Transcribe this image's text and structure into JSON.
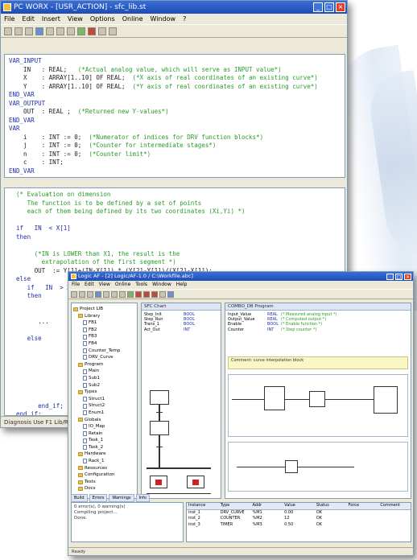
{
  "win1": {
    "title": "PC WORX - [USR_ACTION] - sfc_lib.st",
    "menu": [
      "File",
      "Edit",
      "Insert",
      "View",
      "Options",
      "Online",
      "Window",
      "?"
    ],
    "decl_lines": [
      {
        "c": "kw",
        "t": "VAR_INPUT"
      },
      {
        "c": "tx",
        "t": "    IN   : REAL;   "
      },
      {
        "c": "tx",
        "t": "    X    : ARRAY[1..10] OF REAL;  "
      },
      {
        "c": "tx",
        "t": "    Y    : ARRAY[1..10] OF REAL;  "
      },
      {
        "c": "kw",
        "t": "END_VAR"
      },
      {
        "c": "kw",
        "t": "VAR_OUTPUT"
      },
      {
        "c": "tx",
        "t": "    OUT  : REAL ;  "
      },
      {
        "c": "kw",
        "t": "END_VAR"
      },
      {
        "c": "kw",
        "t": "VAR"
      },
      {
        "c": "tx",
        "t": "    i    : INT := 0;  "
      },
      {
        "c": "tx",
        "t": "    j    : INT := 0;  "
      },
      {
        "c": "tx",
        "t": "    n    : INT := 0;  "
      },
      {
        "c": "tx",
        "t": "    c    : INT;"
      },
      {
        "c": "kw",
        "t": "END_VAR"
      }
    ],
    "decl_comments": [
      "(*Actual analog value, which will serve as INPUT value*)",
      "(*X axis of real coordinates of an existing curve*)",
      "(*Y axis of real coordinates of an existing curve*)",
      "(*Returned new Y-values*)",
      "(*Numerator of indices for DRV function blocks*)",
      "(*Counter for intermediate stages*)",
      "(*Counter limit*)"
    ],
    "body_lines": [
      {
        "c": "cm",
        "t": "  (* Evaluation on dimension"
      },
      {
        "c": "cm",
        "t": "     The function is to be defined by a set of points"
      },
      {
        "c": "cm",
        "t": "     each of them being defined by its two coordinates (Xi,Yi) *)"
      },
      {
        "c": "tx",
        "t": ""
      },
      {
        "c": "kw",
        "t": "  if   IN  < X[1]"
      },
      {
        "c": "kw",
        "t": "  then"
      },
      {
        "c": "tx",
        "t": ""
      },
      {
        "c": "cm",
        "t": "       (*IN is LOWER than X1, the result is the"
      },
      {
        "c": "cm",
        "t": "         extrapolation of the first segment *)"
      },
      {
        "c": "tx",
        "t": "       OUT  := Y[1]+(IN-X[1]) * (Y[2]-Y[1])/(X[2]-X[1]);"
      },
      {
        "c": "kw",
        "t": "  else"
      },
      {
        "c": "kw",
        "t": "     if   IN  > X[n]"
      },
      {
        "c": "kw",
        "t": "     then"
      },
      {
        "c": "tx",
        "t": ""
      },
      {
        "c": "tx",
        "t": ""
      },
      {
        "c": "tx",
        "t": "        ..."
      },
      {
        "c": "tx",
        "t": ""
      },
      {
        "c": "kw",
        "t": "     else"
      },
      {
        "c": "tx",
        "t": ""
      },
      {
        "c": "tx",
        "t": ""
      },
      {
        "c": "tx",
        "t": ""
      },
      {
        "c": "tx",
        "t": ""
      },
      {
        "c": "tx",
        "t": ""
      },
      {
        "c": "tx",
        "t": ""
      },
      {
        "c": "tx",
        "t": ""
      },
      {
        "c": "kw",
        "t": "        end_if;"
      },
      {
        "c": "kw",
        "t": "  end_if;"
      }
    ],
    "status": "Diagnosis Use F1 Lib/RDL"
  },
  "win2": {
    "title": "Logic AF - [2] Logic/AF-1.0 / C:\\Workfile.abc]",
    "menu": [
      "File",
      "Edit",
      "View",
      "Online",
      "Tools",
      "Window",
      "Help"
    ],
    "tree": [
      {
        "d": 0,
        "k": "f",
        "t": "Project LIB"
      },
      {
        "d": 1,
        "k": "f",
        "t": "Library"
      },
      {
        "d": 2,
        "k": "p",
        "t": "FB1"
      },
      {
        "d": 2,
        "k": "p",
        "t": "FB2"
      },
      {
        "d": 2,
        "k": "p",
        "t": "FB3"
      },
      {
        "d": 2,
        "k": "p",
        "t": "FB4"
      },
      {
        "d": 2,
        "k": "p",
        "t": "Counter_Temp"
      },
      {
        "d": 2,
        "k": "p",
        "t": "DRV_Curve"
      },
      {
        "d": 1,
        "k": "f",
        "t": "Program"
      },
      {
        "d": 2,
        "k": "p",
        "t": "Main"
      },
      {
        "d": 2,
        "k": "p",
        "t": "Sub1"
      },
      {
        "d": 2,
        "k": "p",
        "t": "Sub2"
      },
      {
        "d": 1,
        "k": "f",
        "t": "Types"
      },
      {
        "d": 2,
        "k": "p",
        "t": "Struct1"
      },
      {
        "d": 2,
        "k": "p",
        "t": "Struct2"
      },
      {
        "d": 2,
        "k": "p",
        "t": "Enum1"
      },
      {
        "d": 1,
        "k": "f",
        "t": "Globals"
      },
      {
        "d": 2,
        "k": "p",
        "t": "IO_Map"
      },
      {
        "d": 2,
        "k": "p",
        "t": "Retain"
      },
      {
        "d": 2,
        "k": "p",
        "t": "Task_1"
      },
      {
        "d": 2,
        "k": "p",
        "t": "Task_2"
      },
      {
        "d": 1,
        "k": "f",
        "t": "Hardware"
      },
      {
        "d": 2,
        "k": "p",
        "t": "Rack_1"
      },
      {
        "d": 1,
        "k": "f",
        "t": "Resources"
      },
      {
        "d": 1,
        "k": "f",
        "t": "Configuration"
      },
      {
        "d": 1,
        "k": "f",
        "t": "Tests"
      },
      {
        "d": 1,
        "k": "f",
        "t": "Docs"
      }
    ],
    "paneA_title": "SFC Chart",
    "paneB_title": "COMBO_DB Program",
    "vars_a": [
      [
        "Step_Init",
        "BOOL",
        ""
      ],
      [
        "Step_Run",
        "BOOL",
        ""
      ],
      [
        "Trans_1",
        "BOOL",
        ""
      ],
      [
        "Act_Out",
        "INT",
        ""
      ]
    ],
    "vars_b": [
      [
        "Input_Value",
        "REAL",
        "(* Measured analog input *)"
      ],
      [
        "Output_Value",
        "REAL",
        "(* Computed output *)"
      ],
      [
        "Enable",
        "BOOL",
        "(* Enable function *)"
      ],
      [
        "Counter",
        "INT",
        "(* Step counter *)"
      ]
    ],
    "note": "Comment: curve interpolation block",
    "bottom_tabs": [
      "Build",
      "Errors",
      "Warnings",
      "Info"
    ],
    "bottom_text": [
      "0 error(s), 0 warning(s)",
      "Compiling project...",
      "Done."
    ],
    "grid_headers": [
      "Instance",
      "Type",
      "Addr",
      "Value",
      "Status",
      "Force",
      "Comment"
    ],
    "grid_rows": [
      [
        "inst_1",
        "DRV_CURVE",
        "%M1",
        "0.00",
        "OK",
        "",
        ""
      ],
      [
        "inst_2",
        "COUNTER",
        "%M2",
        "12",
        "OK",
        "",
        ""
      ],
      [
        "inst_3",
        "TIMER",
        "%M3",
        "0.50",
        "OK",
        "",
        ""
      ]
    ],
    "status": "Ready"
  }
}
